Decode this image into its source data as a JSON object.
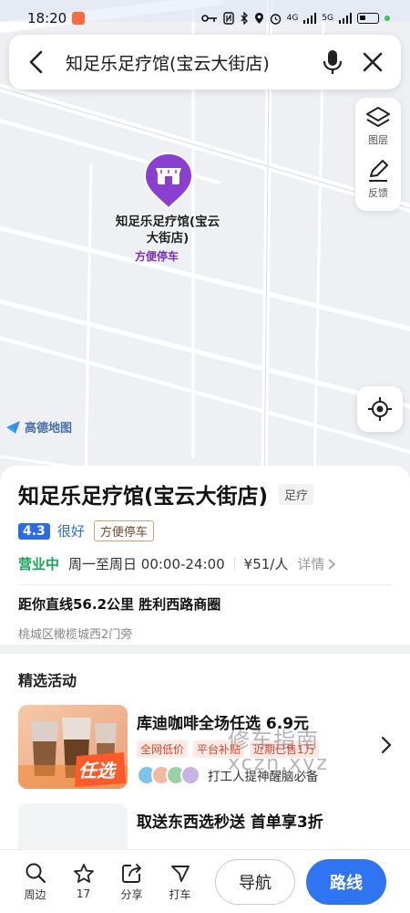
{
  "status_bar": {
    "time": "18:20",
    "network": "4G",
    "signal": "5G",
    "icons": [
      "key-icon",
      "nfc-icon",
      "bluetooth-icon",
      "location-icon",
      "alarm-icon",
      "wifi-icon",
      "battery-icon"
    ]
  },
  "search": {
    "query": "知足乐足疗馆(宝云大街店)"
  },
  "map_tools": {
    "layers_label": "图层",
    "feedback_label": "反馈"
  },
  "map": {
    "pin_name": "知足乐足疗馆(宝云大街店)",
    "pin_tag": "方便停车",
    "logo_text": "高德地图"
  },
  "place": {
    "title": "知足乐足疗馆(宝云大街店)",
    "category": "足疗",
    "rating": "4.3",
    "rating_text": "很好",
    "feature_tag": "方便停车",
    "open_status": "营业中",
    "hours": "周一至周日 00:00-24:00",
    "price": "¥51/人",
    "detail_link": "详情",
    "distance": "距你直线56.2公里 胜利西路商圈",
    "address": "桃城区橄榄城西2门旁"
  },
  "activities": {
    "section_title": "精选活动",
    "items": [
      {
        "title": "库迪咖啡全场任选 6.9元",
        "tags": [
          "全网低价",
          "平台补贴",
          "近期已售1万",
          "已售"
        ],
        "social_text": "打工人提神醒脑必备",
        "badge": "任选"
      },
      {
        "title": "取送东西选秒送 首单享3折"
      }
    ]
  },
  "watermark": {
    "line1": "修车指南",
    "line2": "xczn.xyz"
  },
  "bottom_bar": {
    "nearby_label": "周边",
    "favorite_count": "17",
    "share_label": "分享",
    "taxi_label": "打车",
    "nav_label": "导航",
    "route_label": "路线"
  },
  "colors": {
    "accent_blue": "#2f74f0",
    "pin_purple": "#8a3fd1",
    "open_green": "#1aa35a",
    "promo_red": "#e0452b"
  }
}
